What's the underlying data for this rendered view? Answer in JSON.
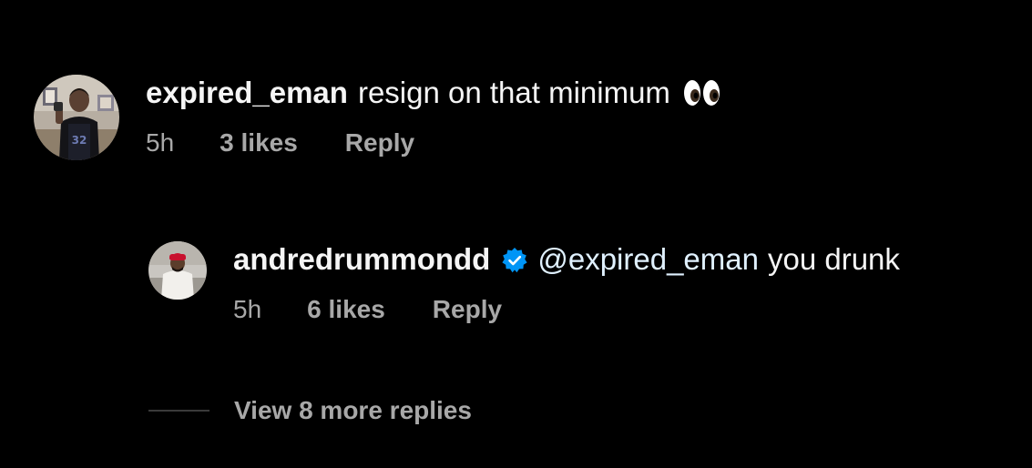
{
  "comments": [
    {
      "username": "expired_eman",
      "text": "resign on that minimum",
      "emoji_icon": "eyes-emoji",
      "time": "5h",
      "likes": "3 likes",
      "reply_label": "Reply"
    }
  ],
  "reply": {
    "username": "andredrummondd",
    "verified": true,
    "mention": "@expired_eman",
    "text": "you drunk",
    "time": "5h",
    "likes": "6 likes",
    "reply_label": "Reply"
  },
  "more_replies_label": "View 8 more replies",
  "colors": {
    "background": "#000000",
    "primary_text": "#f5f5f5",
    "secondary_text": "#a8a8a8",
    "mention": "#e0f1ff",
    "verified_badge": "#0095f6"
  }
}
